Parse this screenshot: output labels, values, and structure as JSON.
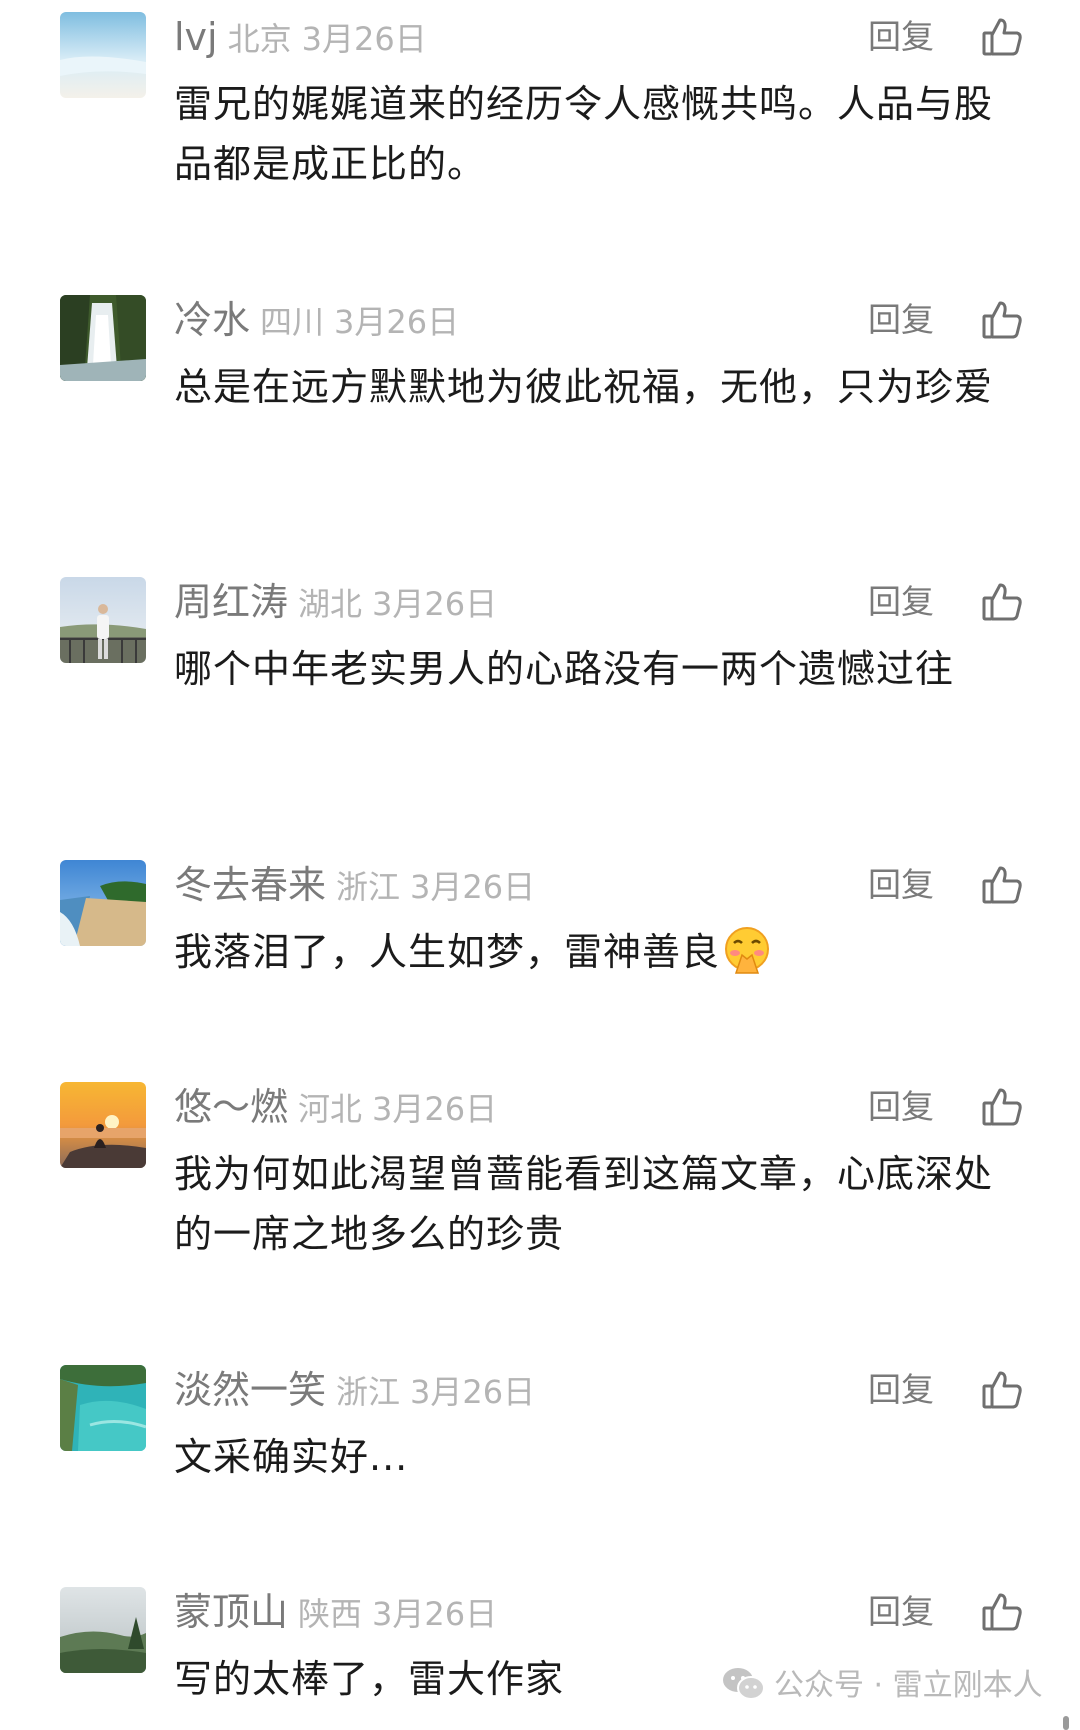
{
  "comments": [
    {
      "name": "lvj",
      "region": "北京",
      "date": "3月26日",
      "reply": "回复",
      "text": "雷兄的娓娓道来的经历令人感慨共鸣。人品与股品都是成正比的。"
    },
    {
      "name": "冷水",
      "region": "四川",
      "date": "3月26日",
      "reply": "回复",
      "text": "总是在远方默默地为彼此祝福，无他，只为珍爱"
    },
    {
      "name": "周红涛",
      "region": "湖北",
      "date": "3月26日",
      "reply": "回复",
      "text": "哪个中年老实男人的心路没有一两个遗憾过往"
    },
    {
      "name": "冬去春来",
      "region": "浙江",
      "date": "3月26日",
      "reply": "回复",
      "text": "我落泪了，人生如梦，雷神善良"
    },
    {
      "name": "悠～燃",
      "region": "河北",
      "date": "3月26日",
      "reply": "回复",
      "text": "我为何如此渴望曾蔷能看到这篇文章，心底深处的一席之地多么的珍贵"
    },
    {
      "name": "淡然一笑",
      "region": "浙江",
      "date": "3月26日",
      "reply": "回复",
      "text": "文采确实好..."
    },
    {
      "name": "蒙顶山",
      "region": "陕西",
      "date": "3月26日",
      "reply": "回复",
      "text": "写的太棒了，雷大作家"
    }
  ],
  "watermark": {
    "text": "公众号 · 雷立刚本人"
  },
  "icons": {
    "like": "thumbs-up-icon",
    "emoji": "shy-face-emoji",
    "watermark": "wechat-icon"
  },
  "colors": {
    "name": "#7a7a7a",
    "meta": "#b4b4b4",
    "text": "#1b1b1b",
    "background": "#ffffff"
  }
}
